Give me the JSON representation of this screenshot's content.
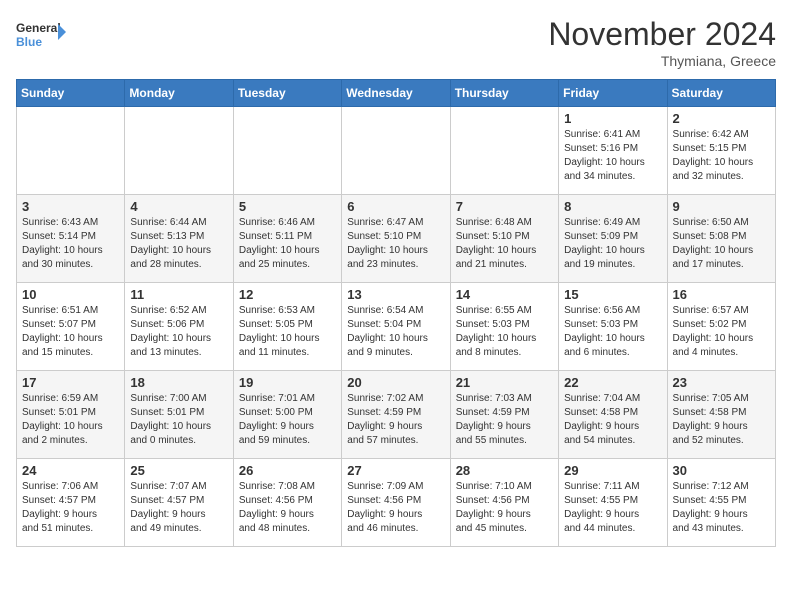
{
  "logo": {
    "line1": "General",
    "line2": "Blue"
  },
  "title": "November 2024",
  "location": "Thymiana, Greece",
  "weekdays": [
    "Sunday",
    "Monday",
    "Tuesday",
    "Wednesday",
    "Thursday",
    "Friday",
    "Saturday"
  ],
  "weeks": [
    [
      {
        "day": "",
        "info": ""
      },
      {
        "day": "",
        "info": ""
      },
      {
        "day": "",
        "info": ""
      },
      {
        "day": "",
        "info": ""
      },
      {
        "day": "",
        "info": ""
      },
      {
        "day": "1",
        "info": "Sunrise: 6:41 AM\nSunset: 5:16 PM\nDaylight: 10 hours\nand 34 minutes."
      },
      {
        "day": "2",
        "info": "Sunrise: 6:42 AM\nSunset: 5:15 PM\nDaylight: 10 hours\nand 32 minutes."
      }
    ],
    [
      {
        "day": "3",
        "info": "Sunrise: 6:43 AM\nSunset: 5:14 PM\nDaylight: 10 hours\nand 30 minutes."
      },
      {
        "day": "4",
        "info": "Sunrise: 6:44 AM\nSunset: 5:13 PM\nDaylight: 10 hours\nand 28 minutes."
      },
      {
        "day": "5",
        "info": "Sunrise: 6:46 AM\nSunset: 5:11 PM\nDaylight: 10 hours\nand 25 minutes."
      },
      {
        "day": "6",
        "info": "Sunrise: 6:47 AM\nSunset: 5:10 PM\nDaylight: 10 hours\nand 23 minutes."
      },
      {
        "day": "7",
        "info": "Sunrise: 6:48 AM\nSunset: 5:10 PM\nDaylight: 10 hours\nand 21 minutes."
      },
      {
        "day": "8",
        "info": "Sunrise: 6:49 AM\nSunset: 5:09 PM\nDaylight: 10 hours\nand 19 minutes."
      },
      {
        "day": "9",
        "info": "Sunrise: 6:50 AM\nSunset: 5:08 PM\nDaylight: 10 hours\nand 17 minutes."
      }
    ],
    [
      {
        "day": "10",
        "info": "Sunrise: 6:51 AM\nSunset: 5:07 PM\nDaylight: 10 hours\nand 15 minutes."
      },
      {
        "day": "11",
        "info": "Sunrise: 6:52 AM\nSunset: 5:06 PM\nDaylight: 10 hours\nand 13 minutes."
      },
      {
        "day": "12",
        "info": "Sunrise: 6:53 AM\nSunset: 5:05 PM\nDaylight: 10 hours\nand 11 minutes."
      },
      {
        "day": "13",
        "info": "Sunrise: 6:54 AM\nSunset: 5:04 PM\nDaylight: 10 hours\nand 9 minutes."
      },
      {
        "day": "14",
        "info": "Sunrise: 6:55 AM\nSunset: 5:03 PM\nDaylight: 10 hours\nand 8 minutes."
      },
      {
        "day": "15",
        "info": "Sunrise: 6:56 AM\nSunset: 5:03 PM\nDaylight: 10 hours\nand 6 minutes."
      },
      {
        "day": "16",
        "info": "Sunrise: 6:57 AM\nSunset: 5:02 PM\nDaylight: 10 hours\nand 4 minutes."
      }
    ],
    [
      {
        "day": "17",
        "info": "Sunrise: 6:59 AM\nSunset: 5:01 PM\nDaylight: 10 hours\nand 2 minutes."
      },
      {
        "day": "18",
        "info": "Sunrise: 7:00 AM\nSunset: 5:01 PM\nDaylight: 10 hours\nand 0 minutes."
      },
      {
        "day": "19",
        "info": "Sunrise: 7:01 AM\nSunset: 5:00 PM\nDaylight: 9 hours\nand 59 minutes."
      },
      {
        "day": "20",
        "info": "Sunrise: 7:02 AM\nSunset: 4:59 PM\nDaylight: 9 hours\nand 57 minutes."
      },
      {
        "day": "21",
        "info": "Sunrise: 7:03 AM\nSunset: 4:59 PM\nDaylight: 9 hours\nand 55 minutes."
      },
      {
        "day": "22",
        "info": "Sunrise: 7:04 AM\nSunset: 4:58 PM\nDaylight: 9 hours\nand 54 minutes."
      },
      {
        "day": "23",
        "info": "Sunrise: 7:05 AM\nSunset: 4:58 PM\nDaylight: 9 hours\nand 52 minutes."
      }
    ],
    [
      {
        "day": "24",
        "info": "Sunrise: 7:06 AM\nSunset: 4:57 PM\nDaylight: 9 hours\nand 51 minutes."
      },
      {
        "day": "25",
        "info": "Sunrise: 7:07 AM\nSunset: 4:57 PM\nDaylight: 9 hours\nand 49 minutes."
      },
      {
        "day": "26",
        "info": "Sunrise: 7:08 AM\nSunset: 4:56 PM\nDaylight: 9 hours\nand 48 minutes."
      },
      {
        "day": "27",
        "info": "Sunrise: 7:09 AM\nSunset: 4:56 PM\nDaylight: 9 hours\nand 46 minutes."
      },
      {
        "day": "28",
        "info": "Sunrise: 7:10 AM\nSunset: 4:56 PM\nDaylight: 9 hours\nand 45 minutes."
      },
      {
        "day": "29",
        "info": "Sunrise: 7:11 AM\nSunset: 4:55 PM\nDaylight: 9 hours\nand 44 minutes."
      },
      {
        "day": "30",
        "info": "Sunrise: 7:12 AM\nSunset: 4:55 PM\nDaylight: 9 hours\nand 43 minutes."
      }
    ]
  ]
}
